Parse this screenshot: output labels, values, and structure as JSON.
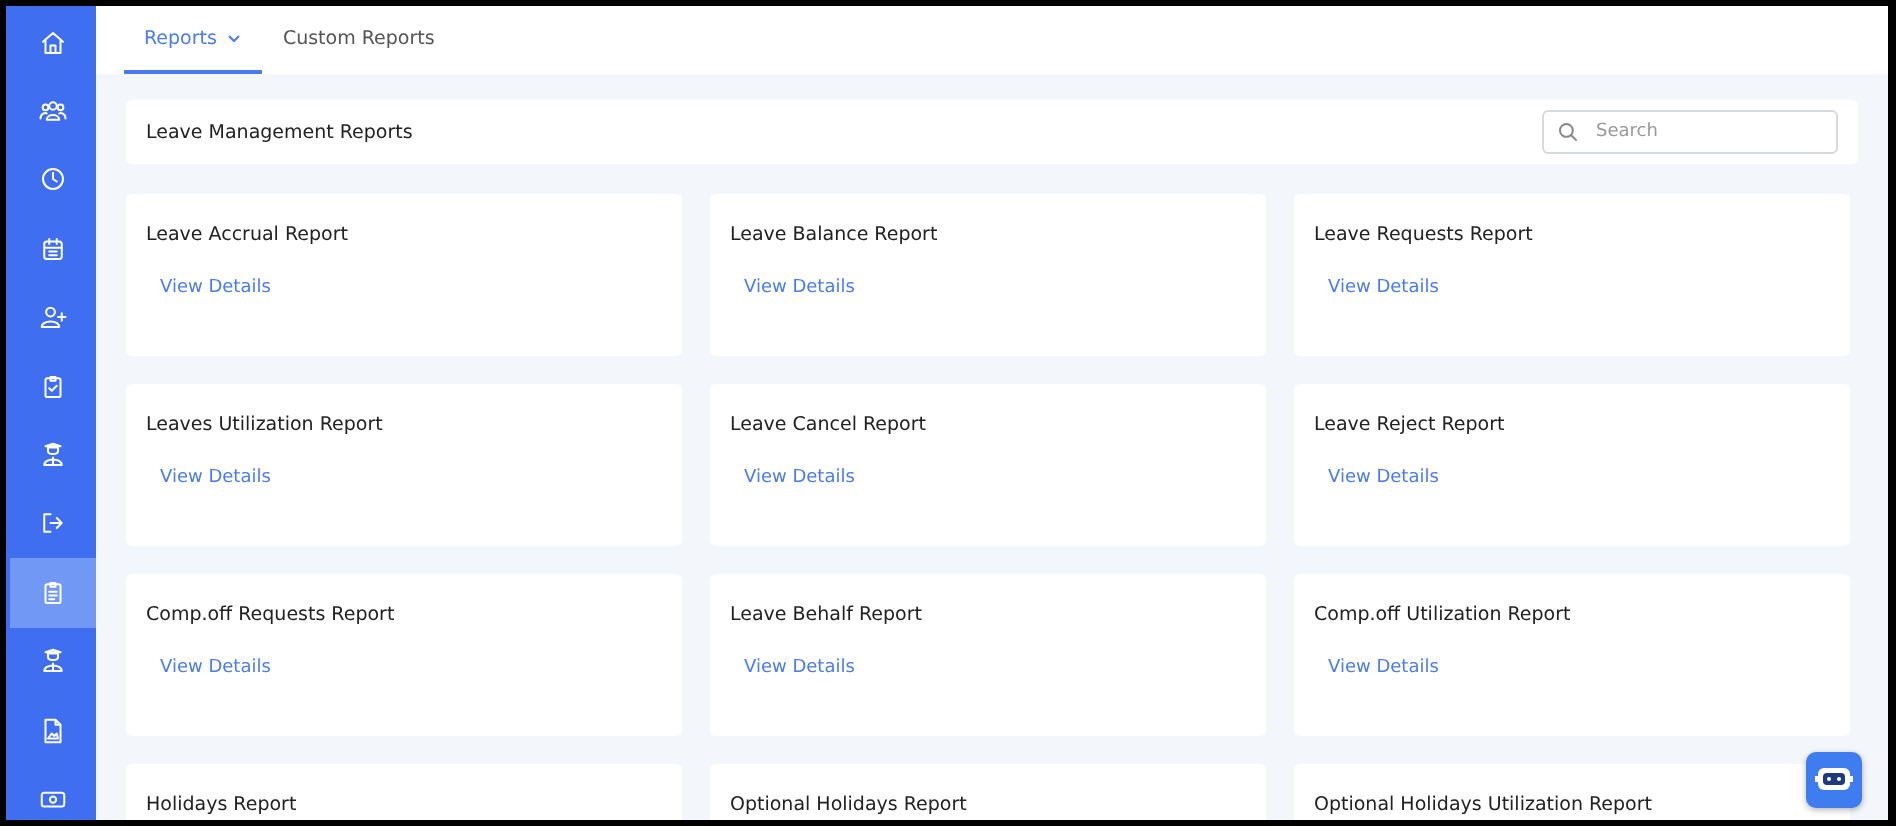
{
  "sidebar": {
    "items": [
      {
        "selected": false
      },
      {
        "selected": false
      },
      {
        "selected": false
      },
      {
        "selected": false
      },
      {
        "selected": false
      },
      {
        "selected": false
      },
      {
        "selected": false
      },
      {
        "selected": false
      },
      {
        "selected": true
      },
      {
        "selected": false
      },
      {
        "selected": false
      },
      {
        "selected": false
      }
    ]
  },
  "tabs": [
    {
      "label": "Reports",
      "selected": true,
      "dropdown": true
    },
    {
      "label": "Custom Reports",
      "selected": false,
      "dropdown": false
    }
  ],
  "header": {
    "title": "Leave Management Reports",
    "search": {
      "placeholder": "Search"
    }
  },
  "cards": [
    {
      "title": "Leave Accrual Report",
      "link": "View Details"
    },
    {
      "title": "Leave Balance Report",
      "link": "View Details"
    },
    {
      "title": "Leave Requests Report",
      "link": "View Details"
    },
    {
      "title": "Leaves Utilization Report",
      "link": "View Details"
    },
    {
      "title": "Leave Cancel Report",
      "link": "View Details"
    },
    {
      "title": "Leave Reject Report",
      "link": "View Details"
    },
    {
      "title": "Comp.off Requests Report",
      "link": "View Details"
    },
    {
      "title": "Leave Behalf Report",
      "link": "View Details"
    },
    {
      "title": "Comp.off Utilization Report",
      "link": "View Details"
    },
    {
      "title": "Holidays Report"
    },
    {
      "title": "Optional Holidays Report"
    },
    {
      "title": "Optional Holidays Utilization Report"
    }
  ]
}
